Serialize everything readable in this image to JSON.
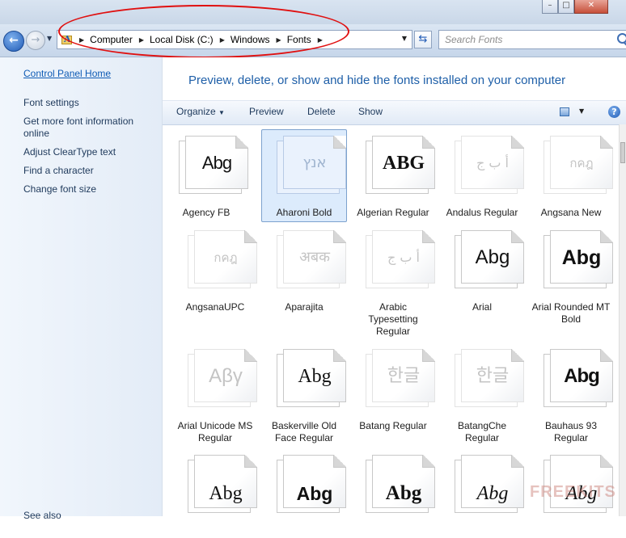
{
  "window": {
    "minimize_glyph": "–",
    "maximize_glyph": "□",
    "close_glyph": "✕"
  },
  "nav": {
    "back_glyph": "←",
    "forward_glyph": "→",
    "breadcrumb": [
      "Computer",
      "Local Disk (C:)",
      "Windows",
      "Fonts"
    ],
    "search_placeholder": "Search Fonts"
  },
  "sidebar": {
    "home": "Control Panel Home",
    "links": [
      "Font settings",
      "Get more font information online",
      "Adjust ClearType text",
      "Find a character",
      "Change font size"
    ],
    "footer": "See also"
  },
  "main": {
    "heading": "Preview, delete, or show and hide the fonts installed on your computer"
  },
  "toolbar": {
    "organize": "Organize",
    "preview": "Preview",
    "delete": "Delete",
    "show": "Show",
    "help": "?"
  },
  "fonts": [
    {
      "name": "Agency FB",
      "sample": "Abg"
    },
    {
      "name": "Aharoni Bold",
      "sample": "אנץ"
    },
    {
      "name": "Algerian Regular",
      "sample": "ABG"
    },
    {
      "name": "Andalus Regular",
      "sample": "أ ب ج"
    },
    {
      "name": "Angsana New",
      "sample": "กคฎ"
    },
    {
      "name": "AngsanaUPC",
      "sample": "กคฎ"
    },
    {
      "name": "Aparajita",
      "sample": "अबक"
    },
    {
      "name": "Arabic Typesetting Regular",
      "sample": "أ ب ج"
    },
    {
      "name": "Arial",
      "sample": "Abg"
    },
    {
      "name": "Arial Rounded MT Bold",
      "sample": "Abg"
    },
    {
      "name": "Arial Unicode MS Regular",
      "sample": "Αβγ"
    },
    {
      "name": "Baskerville Old Face Regular",
      "sample": "Abg"
    },
    {
      "name": "Batang Regular",
      "sample": "한글"
    },
    {
      "name": "BatangChe Regular",
      "sample": "한글"
    },
    {
      "name": "Bauhaus 93 Regular",
      "sample": "Abg"
    },
    {
      "name": "",
      "sample": "Abg"
    },
    {
      "name": "",
      "sample": "Abg"
    },
    {
      "name": "",
      "sample": "Abg"
    },
    {
      "name": "",
      "sample": "Abg"
    },
    {
      "name": "",
      "sample": "Abg"
    }
  ],
  "watermark": "FREEKITS"
}
